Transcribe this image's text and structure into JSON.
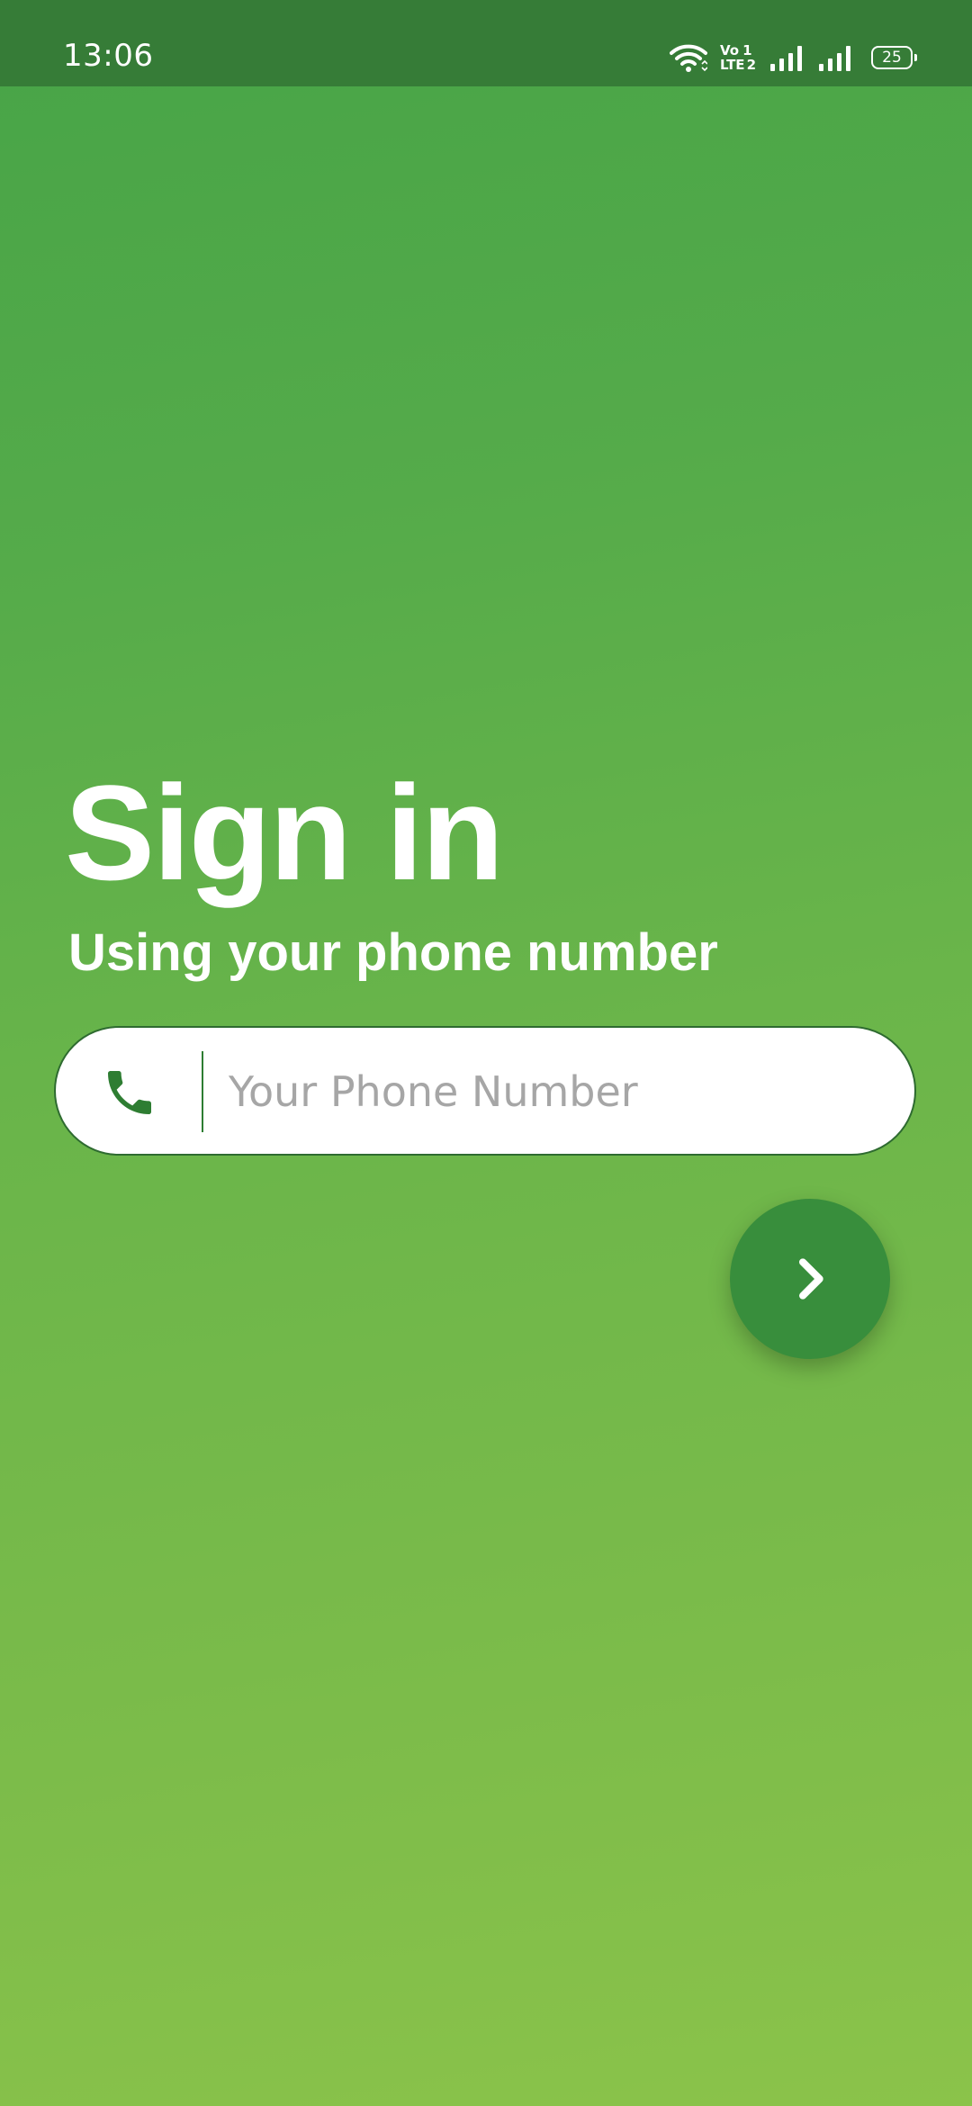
{
  "status_bar": {
    "time": "13:06",
    "network_label_top": "Vo",
    "network_label_bottom": "LTE",
    "sim_top": "1",
    "sim_bottom": "2",
    "battery_level": "25",
    "icons": [
      "wifi-icon",
      "signal-sim1-icon",
      "signal-sim2-icon",
      "battery-icon"
    ]
  },
  "sign_in": {
    "title": "Sign in",
    "subtitle": "Using your phone number"
  },
  "phone_field": {
    "icon": "phone-icon",
    "placeholder": "Your Phone Number",
    "value": ""
  },
  "next_button": {
    "icon": "chevron-right-icon"
  },
  "colors": {
    "status_bar": "#367c37",
    "gradient_top": "#47a447",
    "gradient_bottom": "#8bc34a",
    "accent_dark_green": "#388e3c",
    "phone_icon": "#2e7d32",
    "placeholder_text": "#a6a6a6"
  }
}
